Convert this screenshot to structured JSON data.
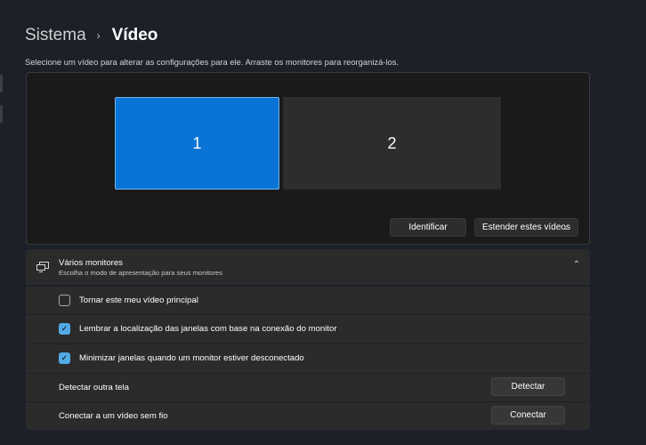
{
  "breadcrumb": {
    "parent": "Sistema",
    "separator": "›",
    "current": "Vídeo"
  },
  "description": "Selecione um vídeo para alterar as configurações para ele. Arraste os monitores para reorganizá-los.",
  "arrangement": {
    "monitors": [
      {
        "label": "1",
        "selected": true
      },
      {
        "label": "2",
        "selected": false
      }
    ],
    "identify_label": "Identificar",
    "mode_select": {
      "value": "Estender estes vídeos",
      "chevron_icon": "chevron-down-icon"
    }
  },
  "multiple_monitors": {
    "icon": "multiple-monitors-icon",
    "title": "Vários monitores",
    "subtitle": "Escolha o modo de apresentação para seus monitores",
    "collapse_icon": "chevron-up-icon",
    "options": [
      {
        "label": "Tornar este meu vídeo principal",
        "checked": false
      },
      {
        "label": "Lembrar a localização das janelas com base na conexão do monitor",
        "checked": true
      },
      {
        "label": "Minimizar janelas quando um monitor estiver desconectado",
        "checked": true
      }
    ],
    "detect": {
      "label": "Detectar outra tela",
      "button": "Detectar"
    },
    "connect": {
      "label": "Conectar a um vídeo sem fio",
      "button": "Conectar"
    }
  },
  "colors": {
    "accent": "#0a74d6",
    "checkbox_on": "#52aae4",
    "background": "#1c2029"
  }
}
